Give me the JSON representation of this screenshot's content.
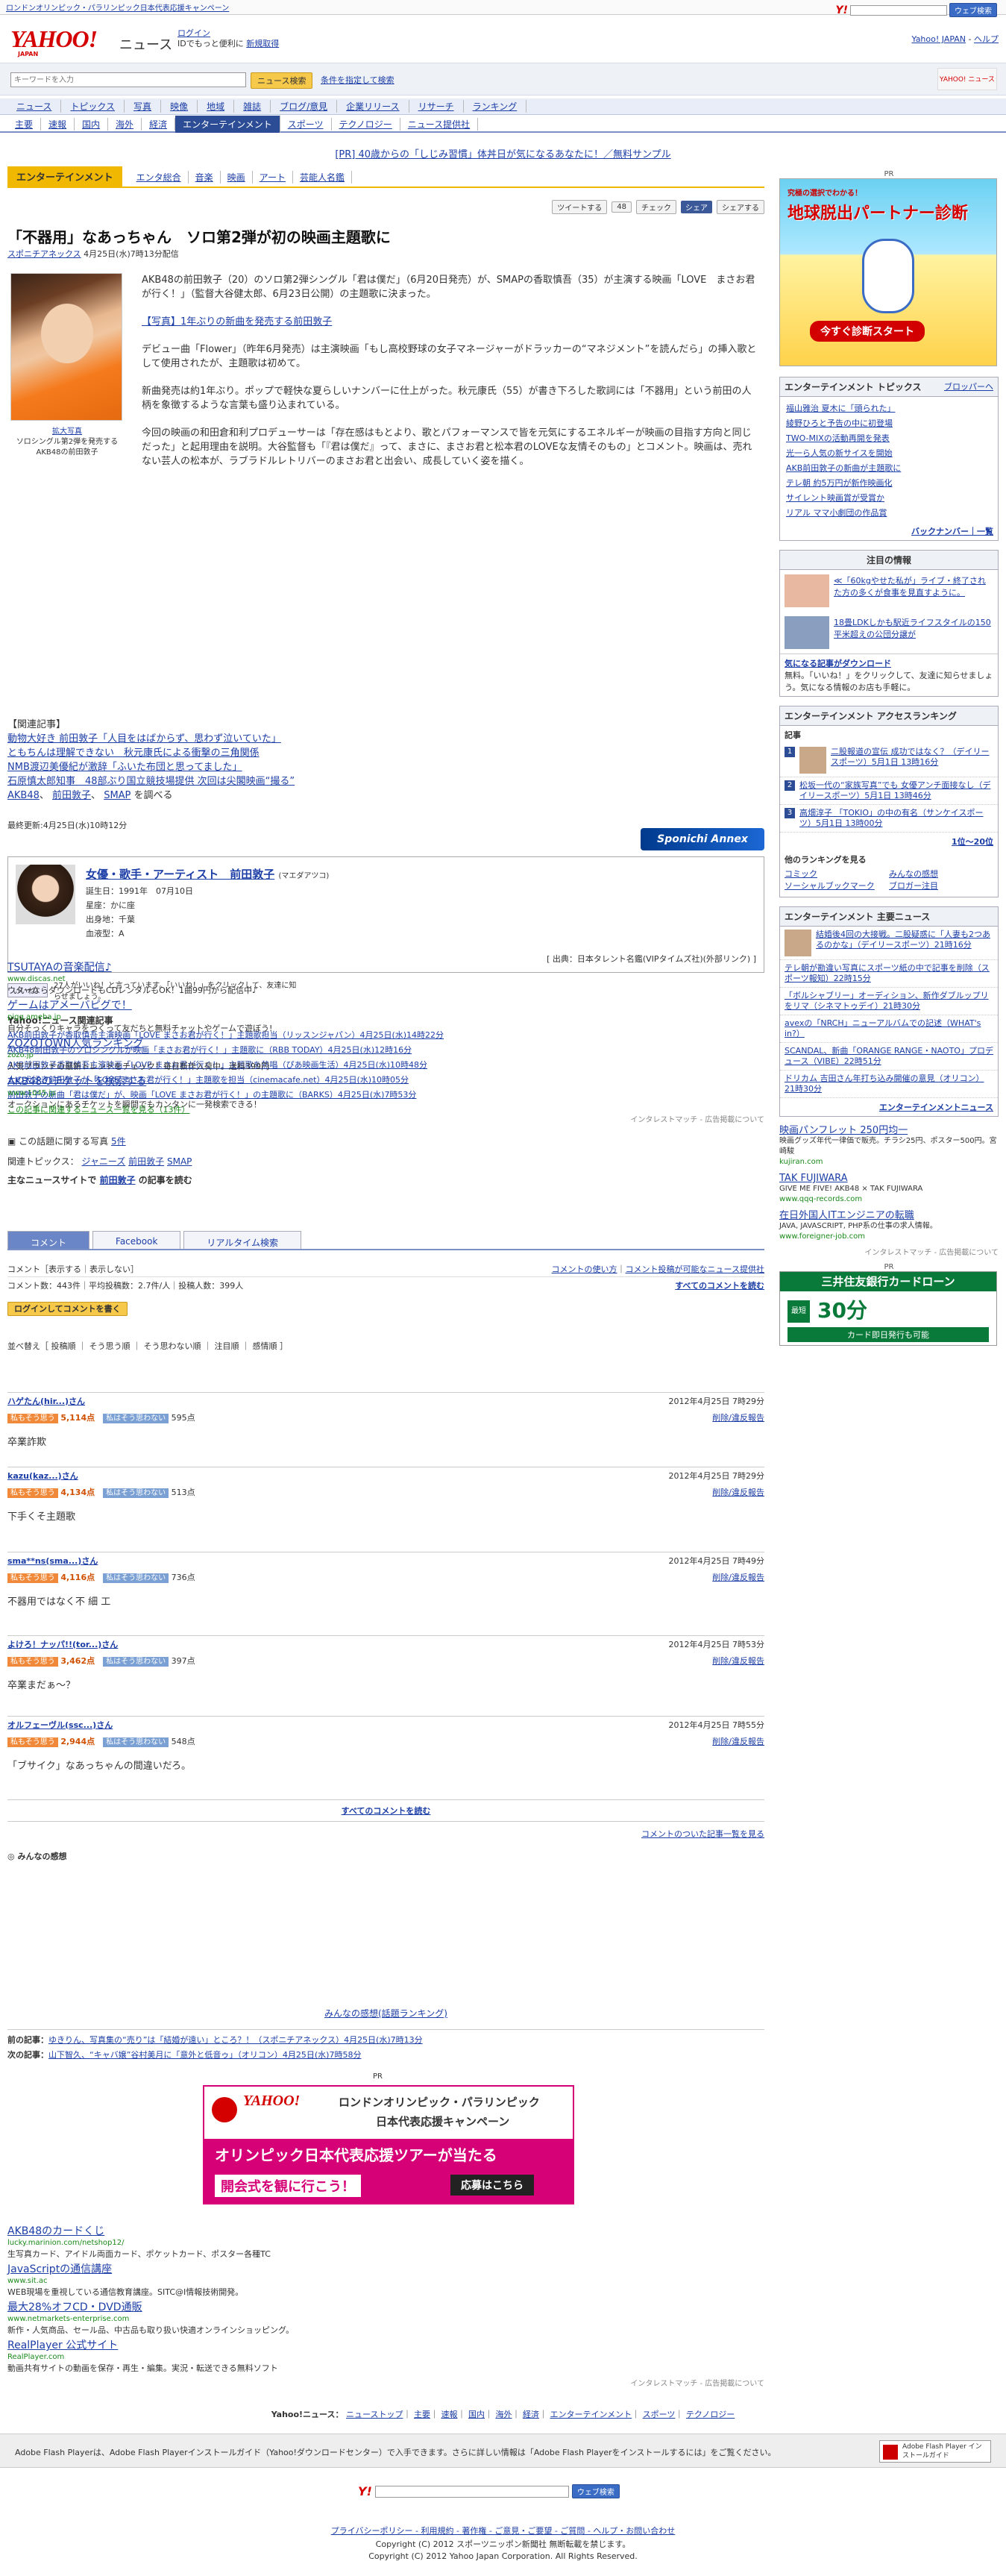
{
  "topbar": {
    "campaign": "ロンドンオリンピック・パラリンピック日本代表応援キャンペーン",
    "search_btn": "ウェブ検索"
  },
  "header": {
    "logo": "YAHOO!",
    "logo_sub": "JAPAN",
    "site": "ニュース",
    "login": "ログイン",
    "login_sub": "IDでもっと便利に",
    "register": "新規取得",
    "home": "Yahoo! JAPAN",
    "help": "ヘルプ"
  },
  "search": {
    "placeholder": "キーワードを入力",
    "button": "ニュース検索",
    "advanced": "条件を指定して検索"
  },
  "nav1": [
    "ニュース",
    "トピックス",
    "写真",
    "映像",
    "地域",
    "雑誌",
    "ブログ/意見",
    "企業リリース",
    "リサーチ",
    "ランキング"
  ],
  "nav2": [
    "主要",
    "速報",
    "国内",
    "海外",
    "経済",
    "エンターテインメント",
    "スポーツ",
    "テクノロジー",
    "ニュース提供社"
  ],
  "pr": "[PR] 40歳からの「しじみ習慣」体丼日が気になるあなたに！／無料サンプル",
  "category": {
    "active": "エンターテインメント",
    "links": [
      "エンタ総合",
      "音楽",
      "映画",
      "アート",
      "芸能人名鑑"
    ]
  },
  "share": {
    "tweet": "ツイートする",
    "tweet_count": "48",
    "check": "チェック",
    "share": "シェア",
    "yahoo": "シェアする"
  },
  "article": {
    "title": "「不器用」なあっちゃん　ソロ第2弾が初の映画主題歌に",
    "source": "スポニチアネックス",
    "date": "4月25日(水)7時13分配信",
    "caption_link": "拡大写真",
    "caption": "ソロシングル第2弾を発売するAKB48の前田敦子",
    "p1": "AKB48の前田敦子（20）のソロ第2弾シングル「君は僕だ」（6月20日発売）が、SMAPの香取慎吾（35）が主演する映画「LOVE　まさお君が行く！」（監督大谷健太郎、6月23日公開）の主題歌に決まった。",
    "p2": "【写真】1年ぶりの新曲を発売する前田敦子",
    "p3": "デビュー曲「Flower」（昨年6月発売）は主演映画「もし高校野球の女子マネージャーがドラッカーの“マネジメント”を読んだら」の挿入歌として使用されたが、主題歌は初めて。",
    "p4": "新曲発売は約1年ぶり。ポップで軽快な夏らしいナンバーに仕上がった。秋元康氏（55）が書き下ろした歌詞には「不器用」という前田の人柄を象徴するような言葉も盛り込まれている。",
    "p5": "今回の映画の和田倉和利プロデューサーは「存在感はもとより、歌とパフォーマンスで皆を元気にするエネルギーが映画の目指す方向と同じだった」と起用理由を説明。大谷監督も「『君は僕だ』って、まさに、まさお君と松本君のLOVEな友情そのもの」とコメント。映画は、売れない芸人の松本が、ラブラドルレトリバーのまさお君と出会い、成長していく姿を描く。",
    "related_head": "【関連記事】",
    "related": [
      "動物大好き 前田敦子「人目をはばからず、思わず泣いていた」",
      "ともちんは理解できない　秋元康氏による衝撃の三角関係",
      "NMB渡辺美優紀が激辞「ふいた布団と思ってました」",
      "石原慎太郎知事　48部ぶり国立競技場提供 次回は尖閣映画“撮る”"
    ],
    "related_tags": [
      "AKB48",
      "前田敦子",
      "SMAP",
      "を調べる"
    ],
    "last_update": "最終更新:4月25日(水)10時12分"
  },
  "profile": {
    "name": "女優・歌手・アーティスト　前田敦子",
    "kana": "(マエダアツコ)",
    "birth": "誕生日：1991年　07月10日",
    "sign": "星座：かに座",
    "place": "出身地：千葉",
    "blood": "血液型：A",
    "source": "[ 出典：日本タレント名鑑(VIPタイムズ社)(外部リンク) ]"
  },
  "like": {
    "btn": "いいね！",
    "text": "27人がいいね！と言っています。「いいね！」をクリックして、友達に知らせましょう。"
  },
  "kanren": {
    "head": "Yahoo!ニュース関連記事",
    "items": [
      "AKB前田敦子が香取慎吾主演映画「LOVE まさお君が行く！」主題歌担当（リッスンジャパン）4月25日(水)14時22分",
      "AKB48前田敦子のソロシングルが映画「まさお君が行く！」主題歌に（RBB TODAY）4月25日(水)12時16分",
      "AKB前田敦子香取慎吾主演映画「LOVE まさお君が行く！」主題歌を熱唱（ぴあ映画生活）4月25日(水)10時48分",
      "大の犬好き前田敦子が「LOVE まさお君が行く！」主題歌を担当（cinemacafe.net）4月25日(水)10時05分",
      "前田敦子の新曲「君は僕だ」が、映画「LOVE まさお君が行く！」の主題歌に（BARKS）4月25日(水)7時53分"
    ],
    "more": "この記事に関連するニュース一覧を見る（13件）"
  },
  "ads": [
    {
      "t": "TSUTAYAの音楽配信♪",
      "u": "www.discas.net",
      "d": "ウタ一ならダウンロードもCDレンタルもOK！1曲99円から配信中♪"
    },
    {
      "t": "ゲームはアメーバピグで！",
      "u": "pigg.ameba.jp",
      "d": "自分そっくりキャラをつくって友だちと無料チャットやゲームで遊ぼう!"
    },
    {
      "t": "ZOZOTOWN人気ランキング",
      "u": "zozo.jp",
      "d": "人気ブランドの最新トレンドをチェック！毎日新作入荷中。送料399円"
    },
    {
      "t": "AKB48のチケットを検索する",
      "u": "www.1045.jp",
      "d": "オークションにあるチケットを瞬間でもカンタンに一発検索できる！"
    }
  ],
  "adinfo": "インタレストマッチ - 広告掲載について",
  "photo5": "この話題に関する写真",
  "photo5n": "5件",
  "topics": {
    "head": "関連トピックス",
    "items": [
      "ジャニーズ",
      "前田敦子",
      "SMAP"
    ]
  },
  "readmore": {
    "prefix": "主なニュースサイトで",
    "name": "前田敦子",
    "suffix": "の記事を読む"
  },
  "tabs": [
    "コメント",
    "Facebook",
    "リアルタイム検索"
  ],
  "comments_bar": {
    "show": "コメント［表示する｜表示しない］",
    "howto": "コメントの使い方",
    "link": "コメント投稿が可能なニュース提供社",
    "count": "コメント数：443件",
    "avg": "平均投稿数：2.7件/人",
    "users": "投稿人数：399人",
    "all": "すべてのコメントを読む",
    "write": "ログインしてコメントを書く",
    "sort": "並べ替え［ 投稿順 ｜ そう思う順 ｜ そう思わない順 ｜ 注目順 ｜ 感情順 ］"
  },
  "comments": [
    {
      "user": "ハゲたん(hir...)さん",
      "date": "2012年4月25日 7時29分",
      "agree": "5,114点",
      "disagree": "595点",
      "text": "卒業詐欺"
    },
    {
      "user": "kazu(kaz...)さん",
      "date": "2012年4月25日 7時29分",
      "agree": "4,134点",
      "disagree": "513点",
      "text": "下手くそ主題歌"
    },
    {
      "user": "sma**ns(sma...)さん",
      "date": "2012年4月25日 7時49分",
      "agree": "4,116点",
      "disagree": "736点",
      "text": "不器用ではなく不 細 工"
    },
    {
      "user": "よけろ！ナッパ!!(tor...)さん",
      "date": "2012年4月25日 7時53分",
      "agree": "3,462点",
      "disagree": "397点",
      "text": "卒業まだぁ～？"
    },
    {
      "user": "オルフェーヴル(ssc...)さん",
      "date": "2012年4月25日 7時55分",
      "agree": "2,944点",
      "disagree": "548点",
      "text": "「ブサイク」なあっちゃんの間違いだろ。"
    }
  ],
  "comment_labels": {
    "agree_label": "私もそう思う",
    "disagree_label": "私はそう思わない",
    "report": "削除/違反報告",
    "all": "すべてのコメントを読む",
    "news_more": "コメントのついた記事一覧を見る"
  },
  "feel": {
    "head": "みんなの感想",
    "ranking": "みんなの感想(話題ランキング)"
  },
  "prevnext": {
    "prev_label": "前の記事：",
    "prev": "ゆきりん、写真集の“売り”は「結婚が遠い」ところ？！（スポニチアネックス）4月25日(水)7時13分",
    "next_label": "次の記事：",
    "next": "山下智久、“キャバ嬢”谷村美月に「意外と低音ゥ」（オリコン）4月25日(水)7時58分"
  },
  "olympic": {
    "t1": "ロンドンオリンピック・パラリンピック",
    "t2": "日本代表応援キャンペーン",
    "t3": "オリンピック日本代表応援ツアーが当たる",
    "t4": "開会式を観に行こう！",
    "t5": "応募はこちら"
  },
  "ads2": [
    {
      "t": "AKB48のカードくじ",
      "u": "lucky.marinion.com/netshop12/",
      "d": "生写真カード、アイドル両面カード、ポケットカード、ポスター各種TC"
    },
    {
      "t": "JavaScriptの通信講座",
      "u": "www.sit.ac",
      "d": "WEB現場を重視している通信教育講座。SITC@I情報技術開発。"
    },
    {
      "t": "最大28%オフCD・DVD通販",
      "u": "www.netmarkets-enterprise.com",
      "d": "新作・人気商品、セール品、中古品も取り扱い快適オンラインショッピング。"
    },
    {
      "t": "RealPlayer 公式サイト",
      "u": "RealPlayer.com",
      "d": "動画共有サイトの動画を保存・再生・編集。実況・転送できる無料ソフト"
    }
  ],
  "footer_nav": {
    "label": "Yahoo!ニュース：",
    "items": [
      "ニューストップ",
      "主要",
      "速報",
      "国内",
      "海外",
      "経済",
      "エンターテインメント",
      "スポーツ",
      "テクノロジー"
    ]
  },
  "flash": {
    "text": "Adobe Flash Playerは、Adobe Flash Playerインストールガイド（Yahoo!ダウンロードセンター）で入手できます。さらに詳しい情報は「Adobe Flash Playerをインストールするには」をご覧ください。",
    "badge": "Adobe Flash Player インストールガイド"
  },
  "bottom_links": "プライバシーポリシー - 利用規約 - 著作権 - ご意見・ご要望 - ご質問 - ヘルプ・お問い合わせ",
  "copy1": "Copyright (C) 2012 スポーツニッポン新聞社 無断転載を禁じます。",
  "copy2": "Copyright (C) 2012 Yahoo Japan Corporation. All Rights Reserved.",
  "right": {
    "pr": "PR",
    "bigad": {
      "t1": "究極の選択でわかる！",
      "t2": "地球脱出パートナー診断",
      "t3": "今すぐ診断スタート"
    },
    "topics_head": "エンターテインメント トピックス",
    "topics_link": "ブロッパーヘ",
    "topics": [
      "福山雅治 夏木に「頭られた」",
      "綾野ひろと予告の中に初登場",
      "TWO-MIXの活動再開を発表",
      "光一ら人気の新サイスを開始",
      "AKB前田敦子の新曲が主題歌に",
      "テレ朝 約5万円が新作映画化",
      "サイレント映画賞が受賞か",
      "リアル ママ小劇団の作品賞"
    ],
    "topics_more": "バックナンバー｜一覧",
    "attention_head": "注目の情報",
    "attention": [
      "≪「60kgやせた私が」ライブ・終了された方の多くが食事を見直すように。",
      "18畳LDKしかも駅近ライフスタイルの150平米超えの公団分譲が"
    ],
    "attention2_head": "気になる記事がダウンロード",
    "attention2": "無料。「いいね！」をクリックして、友達に知らせましょう。気になる情報のお店も手軽に。",
    "ranking_head": "エンターテインメント アクセスランキング",
    "ranking_sub": "記事",
    "ranking": [
      "二股報道の宣伝 成功ではなく？（デイリースポーツ）5月1日 13時16分",
      "松坂一代の“家族写真”でも 女優アンチ面接なし（デイリースポーツ）5月1日 13時46分",
      "高畑淳子 「TOKIO」の中の有名（サンケイスポーツ）5月1日 13時00分"
    ],
    "ranking_more": "1位～20位",
    "other_rank_head": "他のランキングを見る",
    "other_rank": [
      "コミック",
      "みんなの感想",
      "ソーシャルブックマーク",
      "ブロガー注目"
    ],
    "main_head": "エンターテインメント 主要ニュース",
    "main": [
      "結婚後4回の大接戦。二股疑惑に「人妻も2つあるのかな」（デイリースポーツ）21時16分",
      "テレ朝が勘違い写真にスポーツ紙の中で記事を削除（スポーツ報知）22時15分",
      "「ボルシャブリー」オーディション、新作ダブルップリをリマ（シネマトゥデイ）21時30分",
      "avexの「NRCH」ニューアルバムでの記述（WHAT's in?）",
      "SCANDAL、新曲「ORANGE RANGE・NAOTO」プロデュース（VIBE）22時51分",
      "ドリカム 吉田さん年打ち込み開催の意見（オリコン）21時30分"
    ],
    "main_more": "エンターテインメントニュース",
    "ads": [
      {
        "t": "映画パンフレット 250円均一",
        "u": "kujiran.com",
        "d": "映画グッズ年代一律価で販売。チラシ25円、ポスター500円。宮崎駿"
      },
      {
        "t": "TAK FUJIWARA",
        "u": "www.qqq-records.com",
        "d": "GIVE ME FIVE! AKB48 × TAK FUJIWARA"
      },
      {
        "t": "在日外国人ITエンジニアの転職",
        "u": "www.foreigner-job.com",
        "d": "JAVA, JAVASCRIPT, PHP系の仕事の求人情報。"
      }
    ],
    "ads_info": "インタレストマッチ - 広告掲載について",
    "pr2": "PR",
    "card": {
      "t1": "三井住友銀行カードローン",
      "t2": "30分",
      "t3": "最短",
      "t4": "カード即日発行も可能"
    }
  }
}
